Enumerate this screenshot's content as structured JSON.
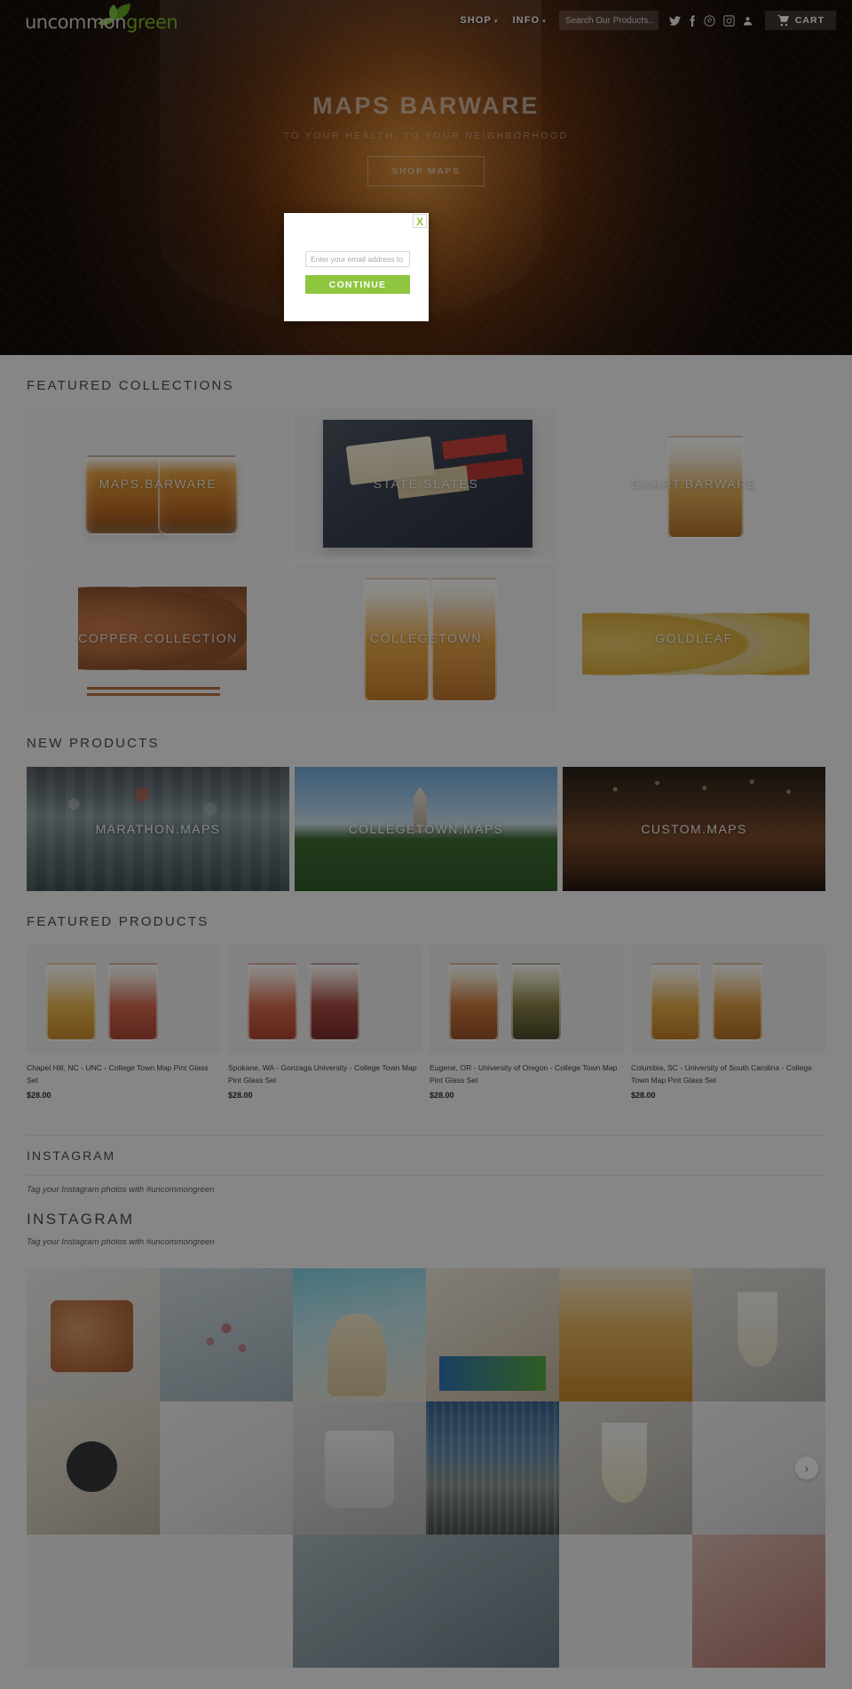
{
  "header": {
    "logo_text": "uncommon",
    "logo_accent": "green",
    "nav": [
      {
        "label": "SHOP",
        "caret": "▾"
      },
      {
        "label": "INFO",
        "caret": "▾"
      }
    ],
    "search_placeholder": "Search Our Products...",
    "social": [
      {
        "name": "twitter-icon"
      },
      {
        "name": "facebook-icon"
      },
      {
        "name": "pinterest-icon"
      },
      {
        "name": "instagram-icon"
      },
      {
        "name": "account-icon"
      }
    ],
    "cart_label": "CART"
  },
  "hero": {
    "title": "MAPS BARWARE",
    "subtitle": "TO YOUR HEALTH, TO YOUR NEIGHBORHOOD",
    "button": "SHOP MAPS"
  },
  "modal": {
    "close_label": "X",
    "email_placeholder": "Enter your email address to receive...",
    "continue_label": "CONTINUE",
    "accent_color": "#8ec63f"
  },
  "featured_collections": {
    "title": "FEATURED COLLECTIONS",
    "items": [
      {
        "label": "MAPS.BARWARE"
      },
      {
        "label": "STATE.SLATES"
      },
      {
        "label": "SMART.BARWARE"
      },
      {
        "label": "COPPER.COLLECTION"
      },
      {
        "label": "COLLEGETOWN"
      },
      {
        "label": "GOLDLEAF"
      }
    ]
  },
  "new_products": {
    "title": "NEW PRODUCTS",
    "items": [
      {
        "label": "MARATHON.MAPS"
      },
      {
        "label": "COLLEGETOWN.MAPS"
      },
      {
        "label": "CUSTOM.MAPS"
      }
    ]
  },
  "featured_products": {
    "title": "FEATURED PRODUCTS",
    "items": [
      {
        "title": "Chapel Hill, NC - UNC - College Town Map Pint Glass Set",
        "price": "$28.00"
      },
      {
        "title": "Spokane, WA - Gonzaga University - College Town Map Pint Glass Set",
        "price": "$28.00"
      },
      {
        "title": "Eugene, OR - University of Oregon - College Town Map Pint Glass Set",
        "price": "$28.00"
      },
      {
        "title": "Columbia, SC - University of South Carolina - College Town Map Pint Glass Set",
        "price": "$28.00"
      }
    ]
  },
  "instagram": {
    "title": "INSTAGRAM",
    "tagline": "Tag your Instagram photos with #uncommongreen",
    "title2": "INSTAGRAM",
    "tagline2": "Tag your Instagram photos with #uncommongreen",
    "next_label": "›"
  }
}
